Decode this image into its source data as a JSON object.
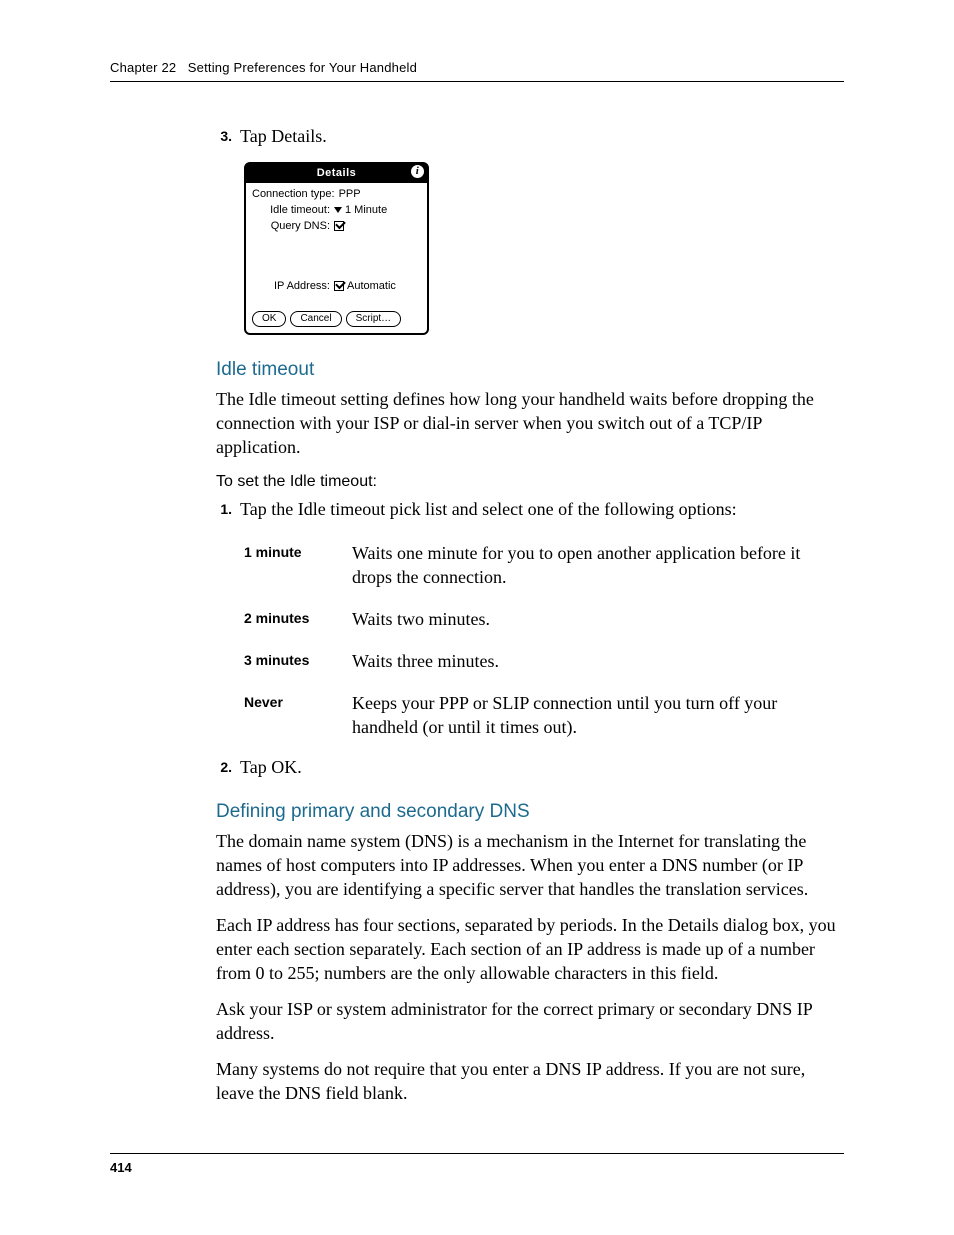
{
  "header": {
    "chapter_label": "Chapter 22",
    "chapter_title": "Setting Preferences for Your Handheld"
  },
  "step3": {
    "num": "3.",
    "text": "Tap Details."
  },
  "dialog": {
    "title": "Details",
    "info_glyph": "i",
    "rows": {
      "conn_type_label": "Connection type:",
      "conn_type_value": "PPP",
      "idle_label": "Idle timeout:",
      "idle_value": "1 Minute",
      "dns_label": "Query DNS:",
      "ip_label": "IP Address:",
      "ip_value": "Automatic"
    },
    "buttons": {
      "ok": "OK",
      "cancel": "Cancel",
      "script": "Script…"
    }
  },
  "sections": {
    "idle_timeout": {
      "heading": "Idle timeout",
      "para": "The Idle timeout setting defines how long your handheld waits before dropping the connection with your ISP or dial-in server when you switch out of a TCP/IP application.",
      "task_heading": "To set the Idle timeout:",
      "step1": {
        "num": "1.",
        "text": "Tap the Idle timeout pick list and select one of the following options:"
      },
      "options": [
        {
          "term": "1 minute",
          "desc": "Waits one minute for you to open another application before it drops the connection."
        },
        {
          "term": "2 minutes",
          "desc": "Waits two minutes."
        },
        {
          "term": "3 minutes",
          "desc": "Waits three minutes."
        },
        {
          "term": "Never",
          "desc": "Keeps your PPP or SLIP connection until you turn off your handheld (or until it times out)."
        }
      ],
      "step2": {
        "num": "2.",
        "text": "Tap OK."
      }
    },
    "dns": {
      "heading": "Defining primary and secondary DNS",
      "p1": "The domain name system (DNS) is a mechanism in the Internet for translating the names of host computers into IP addresses. When you enter a DNS number (or IP address), you are identifying a specific server that handles the translation services.",
      "p2": "Each IP address has four sections, separated by periods. In the Details dialog box, you enter each section separately. Each section of an IP address is made up of a number from 0 to 255; numbers are the only allowable characters in this field.",
      "p3": "Ask your ISP or system administrator for the correct primary or secondary DNS IP address.",
      "p4": "Many systems do not require that you enter a DNS IP address. If you are not sure, leave the DNS field blank."
    }
  },
  "footer": {
    "page_number": "414"
  }
}
